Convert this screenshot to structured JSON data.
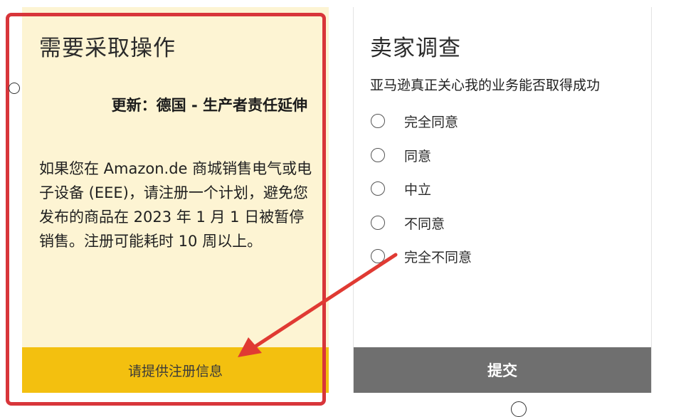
{
  "action_card": {
    "title": "需要采取操作",
    "update": "更新：德国 - 生产者责任延伸",
    "body": "如果您在 Amazon.de 商城销售电气或电子设备 (EEE)，请注册一个计划，避免您发布的商品在 2023 年 1 月 1 日被暂停销售。注册可能耗时 10 周以上。",
    "button_label": "请提供注册信息",
    "background_color": "#fdf4d3",
    "button_color": "#f3c00f"
  },
  "survey_card": {
    "title": "卖家调查",
    "question": "亚马逊真正关心我的业务能否取得成功",
    "options": [
      {
        "label": "完全同意"
      },
      {
        "label": "同意"
      },
      {
        "label": "中立"
      },
      {
        "label": "不同意"
      },
      {
        "label": "完全不同意"
      }
    ],
    "submit_label": "提交",
    "submit_color": "#6f6f6f"
  },
  "annotation": {
    "highlight_color": "#d8353a",
    "arrow_color": "#e03a33"
  }
}
